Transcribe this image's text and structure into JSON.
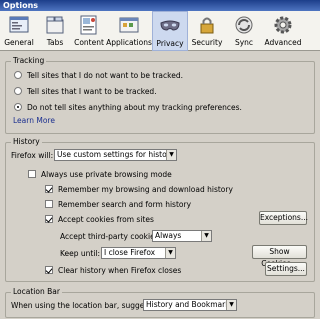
{
  "window": {
    "title": "Options"
  },
  "toolbar": {
    "items": [
      {
        "label": "General",
        "icon": "general-icon"
      },
      {
        "label": "Tabs",
        "icon": "tabs-icon"
      },
      {
        "label": "Content",
        "icon": "content-icon"
      },
      {
        "label": "Applications",
        "icon": "applications-icon"
      },
      {
        "label": "Privacy",
        "icon": "privacy-mask-icon",
        "active": true
      },
      {
        "label": "Security",
        "icon": "security-icon"
      },
      {
        "label": "Sync",
        "icon": "sync-icon"
      },
      {
        "label": "Advanced",
        "icon": "advanced-icon"
      }
    ]
  },
  "tracking": {
    "legend": "Tracking",
    "options": [
      {
        "label": "Tell sites that I do not want to be tracked.",
        "selected": false
      },
      {
        "label": "Tell sites that I want to be tracked.",
        "selected": false
      },
      {
        "label": "Do not tell sites anything about my tracking preferences.",
        "selected": true
      }
    ],
    "learn_more": "Learn More"
  },
  "history": {
    "legend": "History",
    "will_label": "Firefox will:",
    "will_value": "Use custom settings for history",
    "private_mode": {
      "label": "Always use private browsing mode",
      "checked": false
    },
    "remember_browsing": {
      "label": "Remember my browsing and download history",
      "checked": true
    },
    "remember_search": {
      "label": "Remember search and form history",
      "checked": false
    },
    "accept_cookies": {
      "label": "Accept cookies from sites",
      "checked": true
    },
    "exceptions_button": "Exceptions...",
    "third_party_label": "Accept third-party cookies:",
    "third_party_value": "Always",
    "keep_until_label": "Keep until:",
    "keep_until_value": "I close Firefox",
    "show_cookies_button": "Show Cookies...",
    "clear_on_close": {
      "label": "Clear history when Firefox closes",
      "checked": true
    },
    "settings_button": "Settings..."
  },
  "location_bar": {
    "legend": "Location Bar",
    "suggest_label": "When using the location bar, suggest:",
    "suggest_value": "History and Bookmarks"
  }
}
